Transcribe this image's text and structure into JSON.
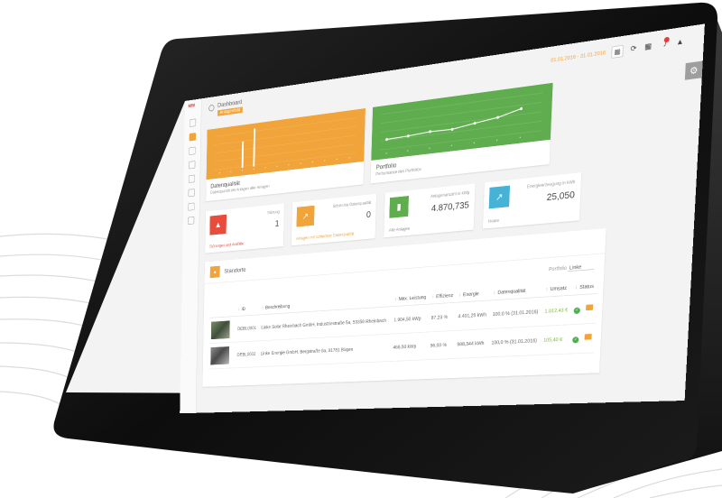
{
  "app": {
    "breadcrumb": "Dashboard",
    "badge": "Anlagenfeld",
    "date_range": "01.01.2016 - 31.01.2016",
    "logo": "MW"
  },
  "icons": {
    "sidebar": [
      "home-icon",
      "dashboard-icon",
      "chart-icon",
      "list-icon",
      "calendar-icon",
      "map-icon",
      "user-icon",
      "settings-icon"
    ],
    "toolbar": [
      "calendar-icon",
      "refresh-icon",
      "grid-icon",
      "bell-icon",
      "user-icon"
    ],
    "gear": "⚙"
  },
  "colors": {
    "accent": "#f0a43a",
    "green": "#5fad4e",
    "red": "#e74c3c",
    "blue": "#46b3d6"
  },
  "cards": {
    "quality": {
      "title": "Datenqualität",
      "subtitle": "Datenqualität der Anlagen aller Anlagen"
    },
    "portfolio": {
      "title": "Portfolio",
      "subtitle": "Performance des Portfolios"
    }
  },
  "kpis": [
    {
      "label": "Störung",
      "value": "1",
      "footer": "Störungen und Ausfälle",
      "icon": "warning-icon",
      "symbol": "▲"
    },
    {
      "label": "Schlechte Datenqualität",
      "value": "0",
      "footer": "Anlagen mit schlechter Datenqualität",
      "icon": "trend-icon",
      "symbol": "↗"
    },
    {
      "label": "Anlagenanzahl in kWp",
      "value": "4.870,735",
      "footer": "Alle Anlagen",
      "icon": "building-icon",
      "symbol": "▮"
    },
    {
      "label": "Energieerzeugung in kWh",
      "value": "25,050",
      "footer": "Heute",
      "icon": "line-chart-icon",
      "symbol": "↗"
    }
  ],
  "panel": {
    "title": "Standorte",
    "filter_label": "Portfolio",
    "filter_value": "Linke"
  },
  "table": {
    "headers": [
      "ID",
      "Beschreibung",
      "Max. Leistung",
      "Effizienz",
      "Energie",
      "Datenqualität",
      "Umsatz",
      "Status"
    ],
    "rows": [
      {
        "id": "DEBL0001",
        "desc": "Linke Solar Rheinbach GmbH, Industriestraße 5a, 53359 Rheinbach",
        "power": "1.904,50 kWp",
        "eff": "87,23 %",
        "energy": "4.401,25 kWh",
        "quality": "100,0 % (31.01.2016)",
        "revenue": "1.012,43 €"
      },
      {
        "id": "DEBL0002",
        "desc": "Linke Energie GmbH, Bergstraße 6a, 91781 Bügen",
        "power": "466,50 kWp",
        "eff": "96,00 %",
        "energy": "988,344 kWh",
        "quality": "100,0 % (31.01.2016)",
        "revenue": "105,40 €"
      }
    ]
  },
  "chart_data": [
    {
      "type": "bar",
      "title": "Datenqualität",
      "categories": [
        "1",
        "2",
        "3",
        "4",
        "5",
        "6",
        "7",
        "8",
        "9",
        "10",
        "11",
        "12"
      ],
      "values": [
        0,
        0,
        70,
        100,
        0,
        0,
        0,
        0,
        0,
        0,
        0,
        0
      ],
      "ylim": [
        0,
        100
      ]
    },
    {
      "type": "line",
      "title": "Portfolio",
      "x": [
        1,
        2,
        3,
        4,
        5,
        6,
        7
      ],
      "values": [
        28,
        30,
        34,
        33,
        41,
        48,
        62
      ],
      "ylim": [
        0,
        100
      ]
    }
  ]
}
